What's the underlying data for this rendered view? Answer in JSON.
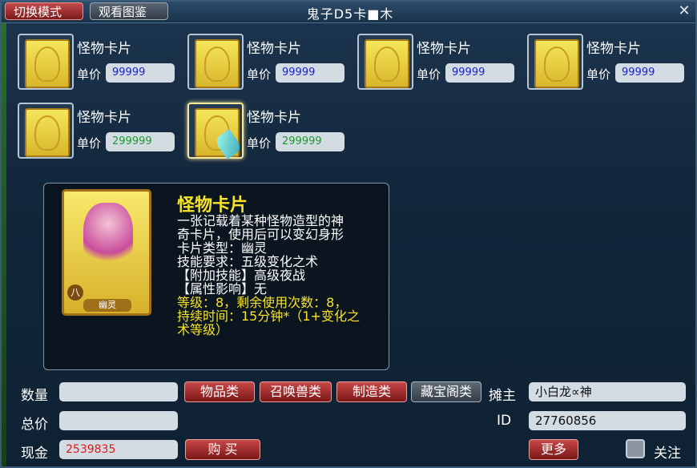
{
  "title": "鬼子D5卡■木",
  "top_buttons": {
    "switch_mode": "切换模式",
    "view_catalog": "观看图鉴"
  },
  "close_glyph": "✕",
  "price_label": "单价",
  "items": [
    {
      "name": "怪物卡片",
      "price": "99999",
      "price_color": "blue"
    },
    {
      "name": "怪物卡片",
      "price": "99999",
      "price_color": "blue"
    },
    {
      "name": "怪物卡片",
      "price": "99999",
      "price_color": "blue"
    },
    {
      "name": "怪物卡片",
      "price": "99999",
      "price_color": "blue"
    },
    {
      "name": "怪物卡片",
      "price": "299999",
      "price_color": "green"
    },
    {
      "name": "怪物卡片",
      "price": "299999",
      "price_color": "green",
      "selected": true
    }
  ],
  "detail": {
    "card_grade": "八",
    "card_label": "幽灵",
    "title": "怪物卡片",
    "lines": [
      "一张记载着某种怪物造型的神",
      "奇卡片，使用后可以变幻身形",
      "卡片类型：幽灵",
      "技能要求：五级变化之术",
      "【附加技能】高级夜战",
      "【属性影响】无"
    ],
    "yellow_lines": [
      "等级：8，剩余使用次数：8，",
      "持续时间：15分钟*（1+变化之",
      "术等级）"
    ]
  },
  "form": {
    "quantity_label": "数量",
    "quantity_value": "",
    "total_label": "总价",
    "total_value": "",
    "cash_label": "现金",
    "cash_value": "2539835",
    "buy_button": "购 买"
  },
  "categories": {
    "goods": "物品类",
    "summon": "召唤兽类",
    "craft": "制造类",
    "treasure": "藏宝阁类"
  },
  "seller": {
    "owner_label": "摊主",
    "owner_value": "小白龙∝神",
    "id_label": "ID",
    "id_value": "27760856",
    "more_button": "更多",
    "follow_label": "关注"
  },
  "colors": {
    "red_button": "#c84848",
    "price_blue": "#1b22c8",
    "price_green": "#1d9a2e",
    "cash_red": "#e01818",
    "highlight_yellow": "#f7e428"
  },
  "icons": [
    "close-icon",
    "monster-card-icon",
    "checkbox-icon"
  ]
}
